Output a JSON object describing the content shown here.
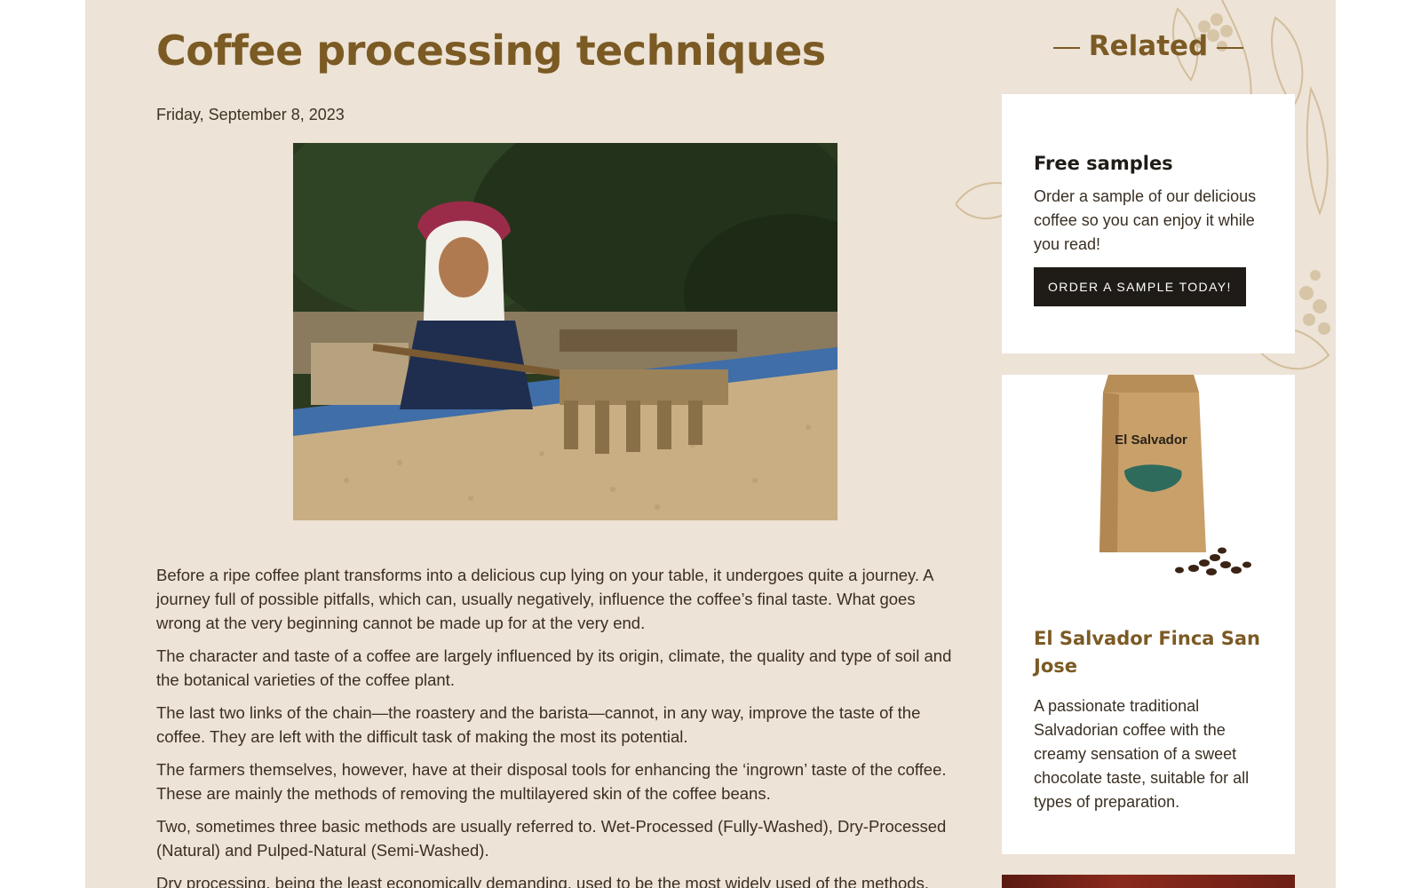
{
  "article": {
    "title": "Coffee processing techniques",
    "date": "Friday, September 8, 2023",
    "paragraphs": [
      "Before a ripe coffee plant transforms into a delicious cup lying on your table, it undergoes quite a journey. A journey full of possible pitfalls, which can, usually negatively, influence the coffee’s final taste. What goes wrong at the very beginning cannot be made up for at the very end.",
      "The character and taste of a coffee are largely influenced by its origin, climate, the quality and type of soil and the botanical varieties of the coffee plant.",
      "The last two links of the chain—the roastery and the barista—cannot, in any way, improve the taste of the coffee. They are left with the difficult task of making the most its potential.",
      "The farmers themselves, however, have at their disposal tools for enhancing the ‘ingrown’ taste of the coffee. These are mainly the methods of removing the multilayered skin of the coffee beans.",
      "Two, sometimes three basic methods are usually referred to. Wet-Processed (Fully-Washed), Dry-Processed (Natural) and Pulped-Natural (Semi-Washed).",
      "Dry processing, being the least economically demanding, used to be the most widely used of the methods."
    ]
  },
  "sidebar": {
    "heading": "Related",
    "samples": {
      "title": "Free samples",
      "text": "Order a sample of our delicious coffee so you can enjoy it while you read!",
      "button": "ORDER A SAMPLE TODAY!"
    },
    "product": {
      "bag_label": "El Salvador",
      "name": "El Salvador Finca San Jose",
      "description": "A passionate traditional Salvadorian coffee with the creamy sensation of a sweet chocolate taste, suitable for all types of preparation."
    }
  },
  "colors": {
    "page_bg": "#ede3d6",
    "accent": "#7b5a24",
    "button_bg": "#1f1c17"
  }
}
